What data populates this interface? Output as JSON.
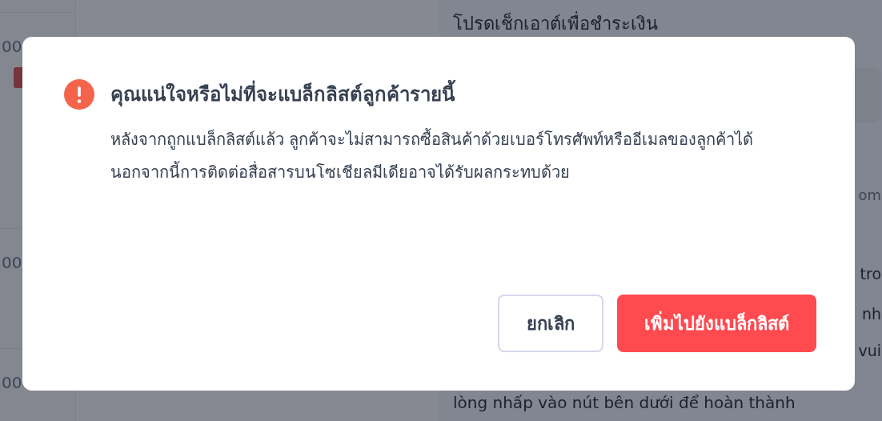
{
  "background": {
    "left_rows": [
      {
        "amount": "00",
        "badge": true
      },
      {
        "amount": "00",
        "badge": false
      },
      {
        "amount": "00",
        "badge": false
      }
    ],
    "right_panel": {
      "heading": "โปรดเช็กเอาต์เพื่อชำระเงิน",
      "card_fragment": "om",
      "fragments": [
        "tro",
        "nh",
        "vui"
      ],
      "footer_line": "lòng nhấp vào nút bên dưới để hoàn thành"
    }
  },
  "dialog": {
    "title": "คุณแน่ใจหรือไม่ที่จะแบล็กลิสต์ลูกค้ารายนี้",
    "message": "หลังจากถูกแบล็กลิสต์แล้ว ลูกค้าจะไม่สามารถซื้อสินค้าด้วยเบอร์โทรศัพท์หรืออีเมลของลูกค้าได้ นอกจากนี้การติดต่อสื่อสารบนโซเชียลมีเดียอาจได้รับผลกระทบด้วย",
    "buttons": [
      {
        "label": "ยกเลิก",
        "kind": "secondary"
      },
      {
        "label": "เพิ่มไปยังแบล็กลิสต์",
        "kind": "danger"
      }
    ]
  }
}
